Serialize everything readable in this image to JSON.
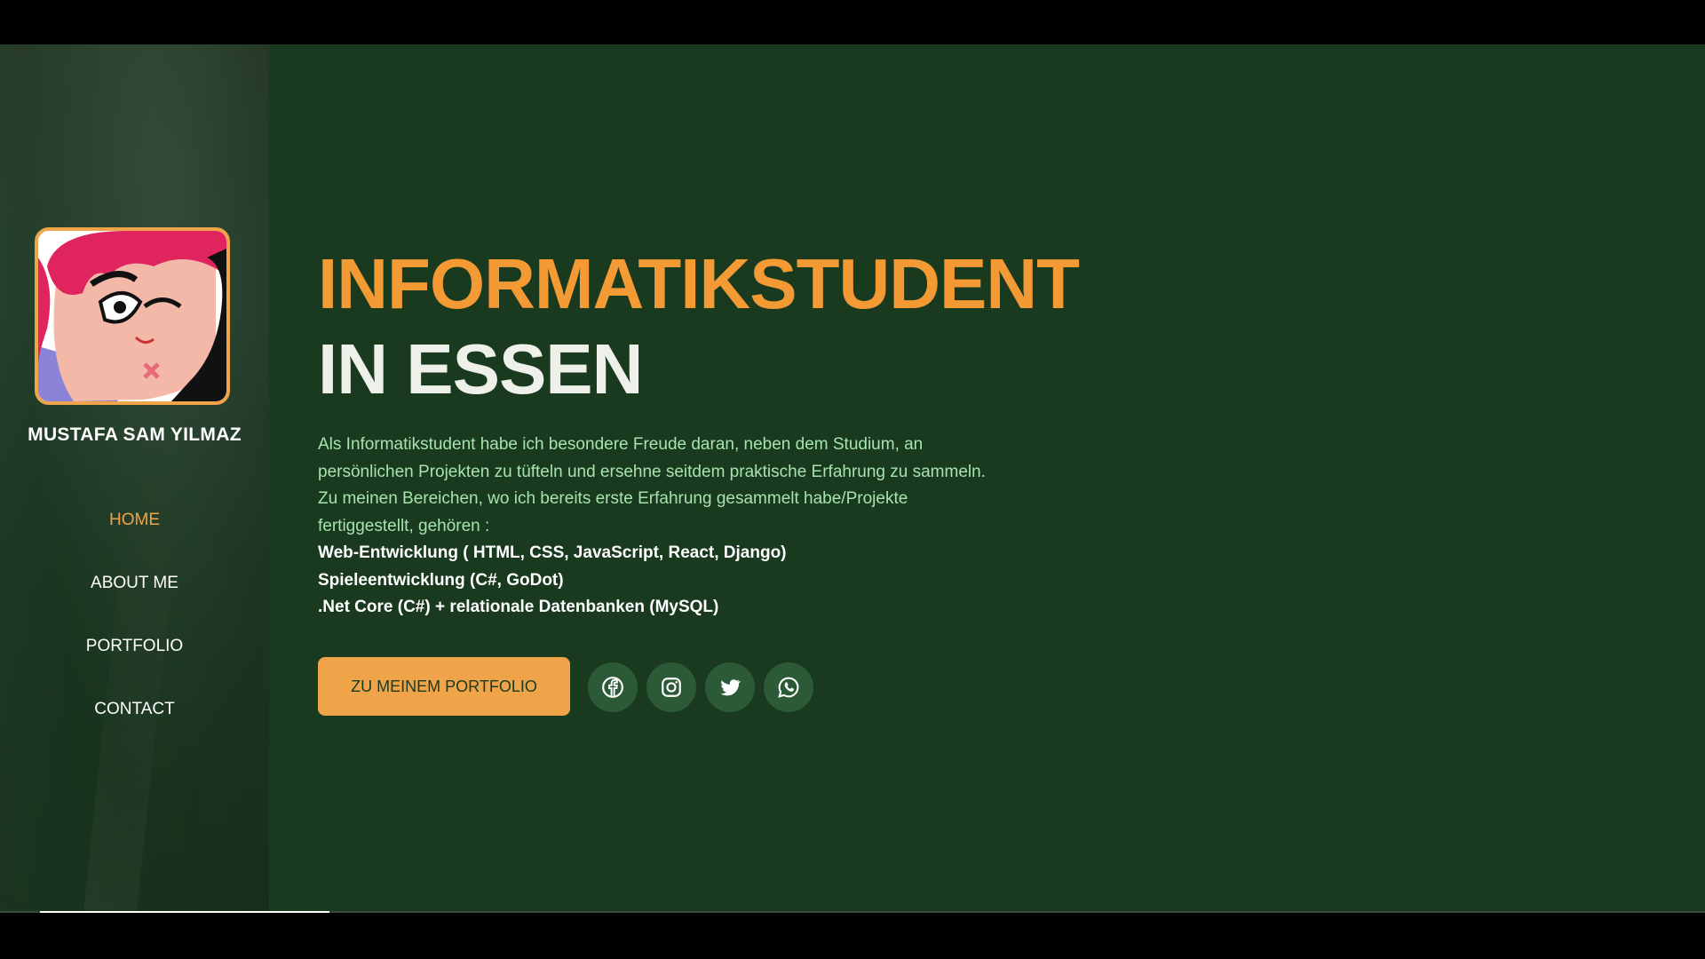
{
  "sidebar": {
    "name": "MUSTAFA SAM YILMAZ",
    "nav": [
      {
        "label": "HOME",
        "active": true
      },
      {
        "label": "ABOUT ME",
        "active": false
      },
      {
        "label": "PORTFOLIO",
        "active": false
      },
      {
        "label": "CONTACT",
        "active": false
      }
    ]
  },
  "hero": {
    "headline_line1": "INFORMATIKSTUDENT",
    "headline_line2": "IN ESSEN",
    "description": "Als Informatikstudent habe ich besondere Freude daran, neben dem Studium, an persönlichen Projekten zu tüfteln und ersehne seitdem praktische Erfahrung zu sammeln. Zu meinen Bereichen, wo ich bereits erste Erfahrung gesammelt habe/Projekte fertiggestellt, gehören :",
    "skills": [
      "Web-Entwicklung ( HTML, CSS, JavaScript, React, Django)",
      "Spieleentwicklung (C#, GoDot)",
      ".Net Core (C#) + relationale Datenbanken (MySQL)"
    ],
    "cta_label": "ZU MEINEM PORTFOLIO",
    "socials": [
      "facebook-icon",
      "instagram-icon",
      "twitter-icon",
      "whatsapp-icon"
    ]
  },
  "colors": {
    "background": "#1a3a1f",
    "accent": "#f0a44a",
    "headline_orange": "#f39a35",
    "description_text": "#a6e3ad",
    "social_circle": "#2c5a36"
  }
}
